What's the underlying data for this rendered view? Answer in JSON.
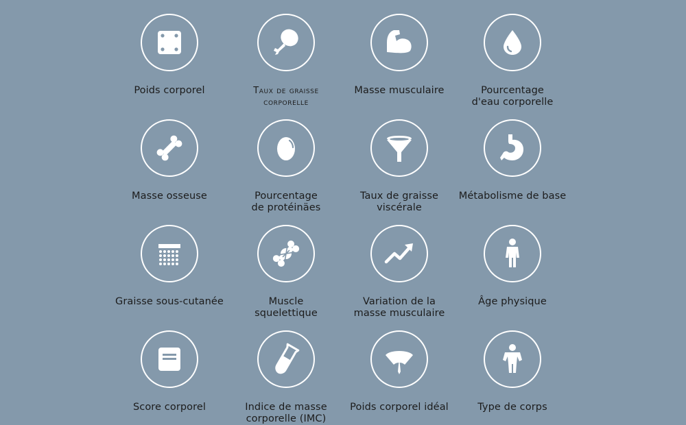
{
  "items": [
    {
      "label": "Poids corporel",
      "icon": "scale-icon"
    },
    {
      "label": "Taux de graisse\ncorporelle",
      "icon": "drumstick-icon"
    },
    {
      "label": "Masse musculaire",
      "icon": "flexed-arm-icon"
    },
    {
      "label": "Pourcentage\nd'eau corporelle",
      "icon": "water-drop-icon"
    },
    {
      "label": "Masse osseuse",
      "icon": "bone-icon"
    },
    {
      "label": "Pourcentage\nde protéinäes",
      "icon": "egg-icon"
    },
    {
      "label": "Taux de graisse\nviscérale",
      "icon": "funnel-icon"
    },
    {
      "label": "Métabolisme de base",
      "icon": "stomach-icon"
    },
    {
      "label": "Graisse sous-cutanée",
      "icon": "calendar-grid-icon"
    },
    {
      "label": "Muscle\nsquelettique",
      "icon": "muscle-bone-icon"
    },
    {
      "label": "Variation de la\nmasse musculaire",
      "icon": "trend-up-icon"
    },
    {
      "label": "Âge physique",
      "icon": "person-icon"
    },
    {
      "label": "Score corporel",
      "icon": "score-card-icon"
    },
    {
      "label": "Indice de masse\ncorporelle (IMC)",
      "icon": "test-tube-icon"
    },
    {
      "label": "Poids corporel idéal",
      "icon": "gauge-icon"
    },
    {
      "label": "Type de corps",
      "icon": "body-type-icon"
    }
  ]
}
